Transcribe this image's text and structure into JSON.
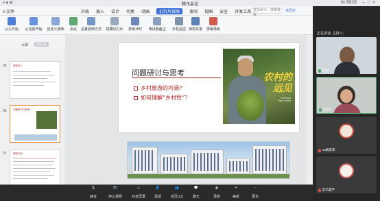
{
  "window": {
    "title": "腾讯会议",
    "time": "01:58:02"
  },
  "wps": {
    "file_label": "≡ 文件",
    "tabs": [
      "开始",
      "插入",
      "设计",
      "切换",
      "动画",
      "幻灯片放映",
      "审阅",
      "视图",
      "安全",
      "开发工具"
    ],
    "active_tab": "幻灯片放映",
    "search_placeholder": "查找命令、搜索模板",
    "sync_label": "未同步",
    "ribbon": [
      "从头开始",
      "从当前开始",
      "自定义放映",
      "会议",
      "设置放映方式",
      "隐藏幻灯片",
      "排练计时",
      "演讲者备注",
      "手机遥控",
      "演讲实录",
      "屏幕录制"
    ],
    "panel_outline": "大纲",
    "panel_slides": "幻灯片",
    "thumbs": [
      {
        "num": "05",
        "title": "课堂导入"
      },
      {
        "num": "06",
        "title": "问题研讨与思考"
      },
      {
        "num": "07",
        "title": "课堂讨论"
      }
    ]
  },
  "slide": {
    "title": "问题研讨与思考",
    "bullets": [
      "乡村旅游的内涵?",
      "如何理解“乡村性”？"
    ],
    "magazine_title": "农村的\n远见",
    "magazine_sub": "The Rural\nFarm Future"
  },
  "participants": {
    "header": "正在讲话: 主持人;",
    "tiles": [
      {
        "name": "马国",
        "mic": "on"
      },
      {
        "name": "主持人",
        "mic": "on"
      },
      {
        "name": "34桃李荣",
        "mic": "off"
      },
      {
        "name": "彭丰晨宇",
        "mic": "off"
      }
    ]
  },
  "toolbar": {
    "buttons": [
      "静音",
      "停止视频",
      "共享屏幕",
      "邀请",
      "成员(11)",
      "聊天",
      "录制",
      "美颜",
      "更多"
    ]
  }
}
